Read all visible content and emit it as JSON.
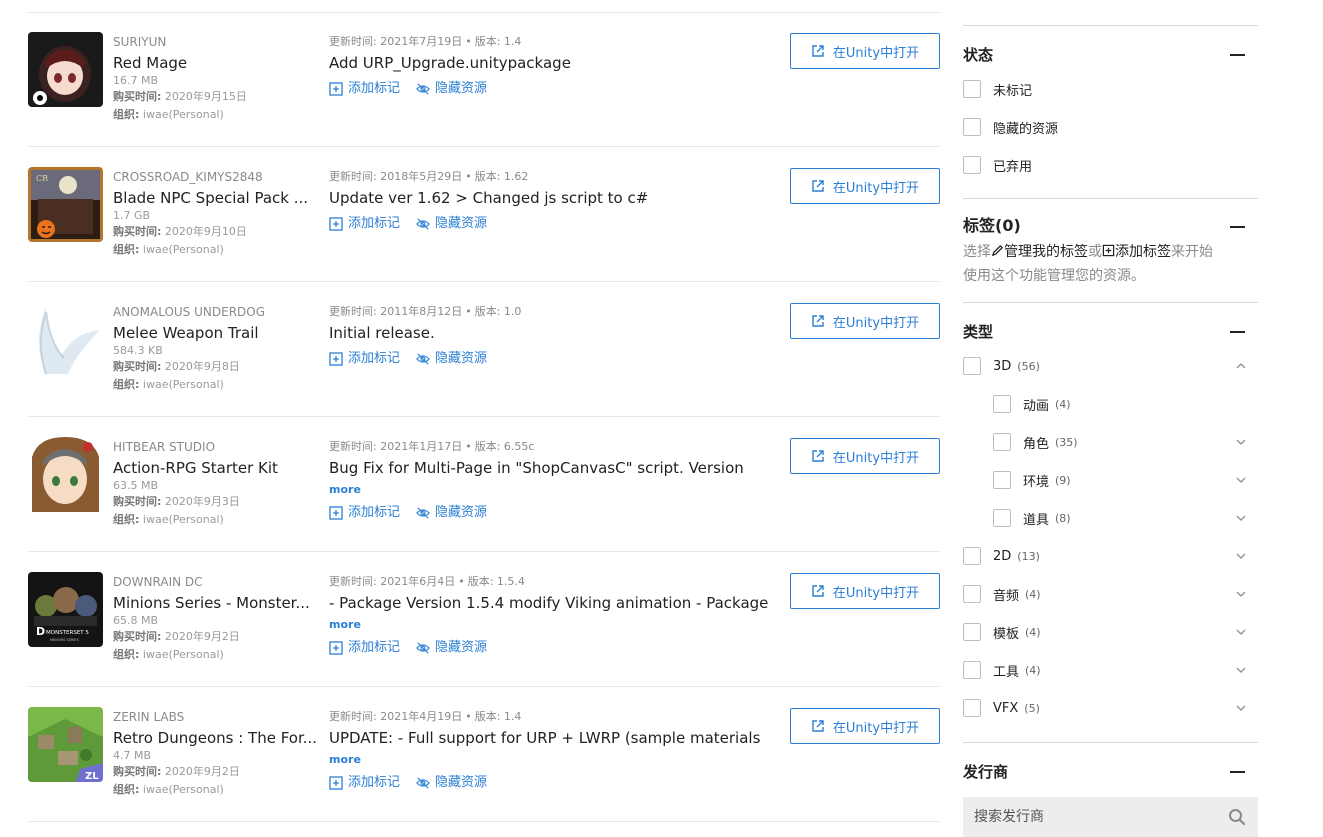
{
  "labels": {
    "update_prefix": "更新时间: ",
    "version_prefix": "版本: ",
    "bullet": "•",
    "purchase_key": "购买时间:",
    "org_key": "组织:",
    "add_tag": "添加标记",
    "hide_asset": "隐藏资源",
    "open_in_unity": "在Unity中打开",
    "more": "more"
  },
  "assets": [
    {
      "publisher": "SURIYUN",
      "name": "Red Mage",
      "size": "16.7 MB",
      "purchase_date": "2020年9月15日",
      "org": "iwae(Personal)",
      "update_date": "2021年7月19日",
      "version": "1.4",
      "update_text": "Add URP_Upgrade.unitypackage",
      "has_more": false,
      "thumb_icon": "red-mage-thumbnail"
    },
    {
      "publisher": "CROSSROAD_KIMYS2848",
      "name": "Blade NPC Special Pack ...",
      "size": "1.7 GB",
      "purchase_date": "2020年9月10日",
      "org": "iwae(Personal)",
      "update_date": "2018年5月29日",
      "version": "1.62",
      "update_text": "Update ver 1.62 > Changed js script to c#",
      "has_more": false,
      "thumb_icon": "blade-npc-thumbnail"
    },
    {
      "publisher": "ANOMALOUS UNDERDOG",
      "name": "Melee Weapon Trail",
      "size": "584.3 KB",
      "purchase_date": "2020年9月8日",
      "org": "iwae(Personal)",
      "update_date": "2011年8月12日",
      "version": "1.0",
      "update_text": "Initial release.",
      "has_more": false,
      "thumb_icon": "weapon-trail-thumbnail"
    },
    {
      "publisher": "HITBEAR STUDIO",
      "name": "Action-RPG Starter Kit",
      "size": "63.5 MB",
      "purchase_date": "2020年9月3日",
      "org": "iwae(Personal)",
      "update_date": "2021年1月17日",
      "version": "6.55c",
      "update_text": "Bug Fix for Multi-Page in \"ShopCanvasC\" script. Version",
      "has_more": true,
      "thumb_icon": "action-rpg-thumbnail"
    },
    {
      "publisher": "DOWNRAIN DC",
      "name": "Minions Series - Monster...",
      "size": "65.8 MB",
      "purchase_date": "2020年9月2日",
      "org": "iwae(Personal)",
      "update_date": "2021年6月4日",
      "version": "1.5.4",
      "update_text": "- Package Version 1.5.4 modify Viking animation - Package",
      "has_more": true,
      "thumb_icon": "minions-series-thumbnail",
      "thumb_text": "MONSTERSET 5",
      "thumb_subtext": "MINIONS SERIES"
    },
    {
      "publisher": "ZERIN LABS",
      "name": "Retro Dungeons : The For...",
      "size": "4.7 MB",
      "purchase_date": "2020年9月2日",
      "org": "iwae(Personal)",
      "update_date": "2021年4月19日",
      "version": "1.4",
      "update_text": "UPDATE: - Full support for URP + LWRP (sample materials",
      "has_more": true,
      "thumb_icon": "retro-dungeons-thumbnail",
      "thumb_text": "ZL"
    }
  ],
  "sidebar": {
    "status": {
      "title": "状态",
      "options": [
        "未标记",
        "隐藏的资源",
        "已弃用"
      ]
    },
    "tags": {
      "title": "标签(0)",
      "desc_choose": "选择",
      "desc_manage": "管理我的标签",
      "desc_or": "或",
      "desc_add": "添加标签",
      "desc_start": "来开始",
      "desc_line2": "使用这个功能管理您的资源。"
    },
    "types": {
      "title": "类型",
      "items": [
        {
          "label": "3D",
          "count": "(56)",
          "level": 0,
          "expanded": true
        },
        {
          "label": "动画",
          "count": "(4)",
          "level": 1,
          "expanded": null
        },
        {
          "label": "角色",
          "count": "(35)",
          "level": 1,
          "expanded": false
        },
        {
          "label": "环境",
          "count": "(9)",
          "level": 1,
          "expanded": false
        },
        {
          "label": "道具",
          "count": "(8)",
          "level": 1,
          "expanded": false
        },
        {
          "label": "2D",
          "count": "(13)",
          "level": 0,
          "expanded": false
        },
        {
          "label": "音频",
          "count": "(4)",
          "level": 0,
          "expanded": false
        },
        {
          "label": "模板",
          "count": "(4)",
          "level": 0,
          "expanded": false
        },
        {
          "label": "工具",
          "count": "(4)",
          "level": 0,
          "expanded": false
        },
        {
          "label": "VFX",
          "count": "(5)",
          "level": 0,
          "expanded": false
        }
      ]
    },
    "publisher": {
      "title": "发行商",
      "search_placeholder": "搜索发行商"
    }
  },
  "colors": {
    "link": "#2b7fd4",
    "divider": "#e6e6e6",
    "muted": "#8a8a8a",
    "search_bg": "#ededed"
  }
}
